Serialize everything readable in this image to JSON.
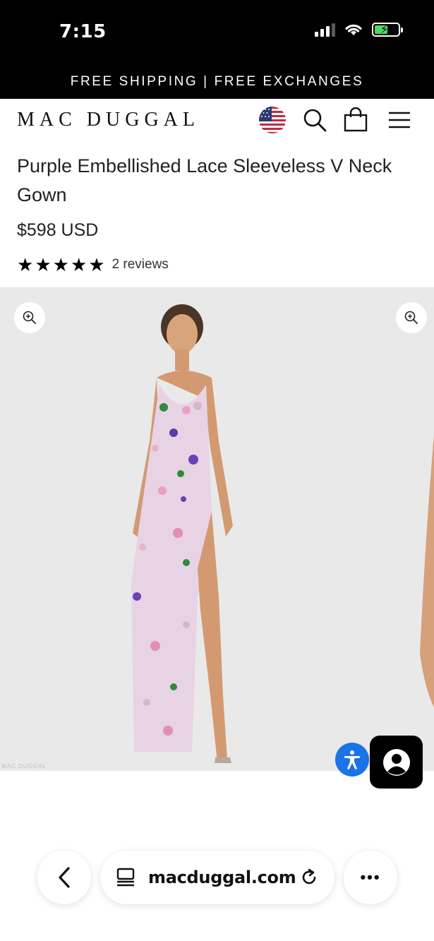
{
  "status_bar": {
    "time": "7:15",
    "icons": [
      "signal-icon",
      "wifi-icon",
      "battery-charging-icon"
    ]
  },
  "promo_banner": {
    "text": "FREE SHIPPING | FREE EXCHANGES"
  },
  "header": {
    "logo": "MAC DUGGAL",
    "icons": [
      "us-flag-icon",
      "search-icon",
      "shopping-bag-icon",
      "hamburger-menu-icon"
    ]
  },
  "product": {
    "title": "Purple Embellished Lace Sleeveless V Neck Gown",
    "price": "$598 USD",
    "rating": 5,
    "rating_max": 5,
    "reviews_label": "2 reviews"
  },
  "gallery": {
    "watermark": "MAC DUGGAL",
    "background_color": "#e9e9ea",
    "dress_color": "#e8d3e4"
  },
  "floating": {
    "accessibility_color": "#1a73e8",
    "account_color": "#000000"
  },
  "browser": {
    "url": "macduggal.com"
  }
}
